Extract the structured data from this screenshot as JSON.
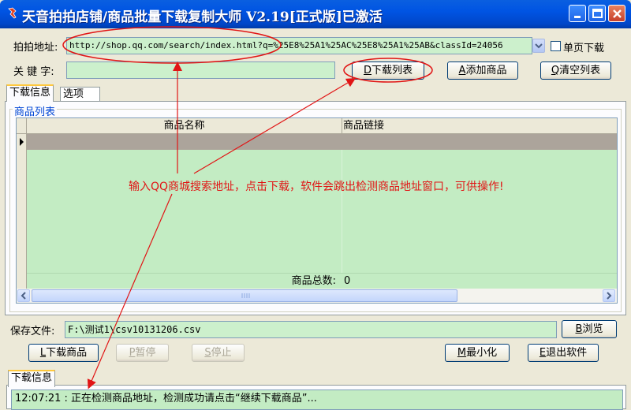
{
  "window": {
    "title": "天音拍拍店铺/商品批量下载复制大师 V2.19[正式版]已激活"
  },
  "form": {
    "address_label": "拍拍地址:",
    "address_value": "http://shop.qq.com/search/index.html?q=%25E8%25A1%25AC%25E8%25A1%25AB&classId=24056",
    "single_page_label": "单页下载",
    "keyword_label": "关 键 字:",
    "keyword_value": "",
    "download_list_key": "D",
    "download_list_label": "下载列表",
    "add_product_key": "A",
    "add_product_label": "添加商品",
    "clear_list_key": "Q",
    "clear_list_label": "清空列表"
  },
  "tabs": [
    {
      "label": "下载信息"
    },
    {
      "label": "选项"
    }
  ],
  "product_list": {
    "group_title": "商品列表",
    "columns": [
      "商品名称",
      "商品链接"
    ],
    "total_label": "商品总数:",
    "total_value": "0"
  },
  "annotation": "输入QQ商城搜索地址，点击下载，软件会跳出检测商品地址窗口，可供操作!",
  "save": {
    "label": "保存文件:",
    "path": "F:\\测试1\\csv10131206.csv",
    "browse_key": "B",
    "browse_label": "浏览"
  },
  "actions": {
    "download_key": "L",
    "download_label": "下载商品",
    "pause_key": "P",
    "pause_label": "暂停",
    "stop_key": "S",
    "stop_label": "停止",
    "minimize_key": "M",
    "minimize_label": "最小化",
    "exit_key": "E",
    "exit_label": "退出软件"
  },
  "log": {
    "tab_label": "下载信息",
    "message": "12:07:21 : 正在检测商品地址，检测成功请点击“继续下载商品”..."
  },
  "colors": {
    "title_bar": "#0054e3",
    "input_bg": "#ccf0cc",
    "annotation": "#e11515",
    "group_title": "#0046d5"
  }
}
